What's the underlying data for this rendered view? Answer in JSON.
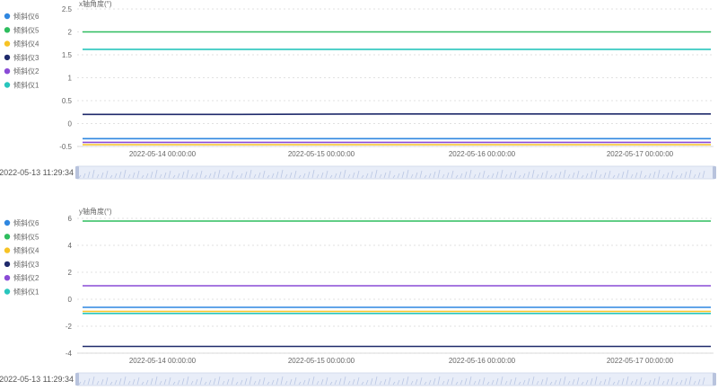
{
  "chart_data": [
    {
      "type": "line",
      "ylabel": "x轴角度(°)",
      "ylim": [
        -0.5,
        2.5
      ],
      "yticks": [
        "2.5",
        "2",
        "1.5",
        "1",
        "0.5",
        "0",
        "-0.5"
      ],
      "x_ticks": [
        "2022-05-14 00:00:00",
        "2022-05-15 00:00:00",
        "2022-05-16 00:00:00",
        "2022-05-17 00:00:00"
      ],
      "x_range": [
        "2022-05-13 11:29:34",
        "2022-05-17 20:00:00"
      ],
      "legend": [
        "倾斜仪6",
        "倾斜仪5",
        "倾斜仪4",
        "倾斜仪3",
        "倾斜仪2",
        "倾斜仪1"
      ],
      "grid": true,
      "series": [
        {
          "name": "倾斜仪6",
          "color": "#2f87e0",
          "values": [
            -0.33,
            -0.33,
            -0.33,
            -0.33,
            -0.33
          ]
        },
        {
          "name": "倾斜仪5",
          "color": "#2ebd5e",
          "values": [
            2.0,
            2.0,
            2.0,
            2.0,
            2.0
          ]
        },
        {
          "name": "倾斜仪4",
          "color": "#f7c325",
          "values": [
            -0.46,
            -0.46,
            -0.46,
            -0.46,
            -0.46
          ]
        },
        {
          "name": "倾斜仪3",
          "color": "#1f2a6b",
          "values": [
            0.2,
            0.2,
            0.21,
            0.21,
            0.21
          ]
        },
        {
          "name": "倾斜仪2",
          "color": "#8a4bd6",
          "values": [
            -0.41,
            -0.41,
            -0.41,
            -0.41,
            -0.41
          ]
        },
        {
          "name": "倾斜仪1",
          "color": "#28c6bd",
          "values": [
            1.62,
            1.62,
            1.62,
            1.62,
            1.62
          ]
        }
      ],
      "slider_label": "2022-05-13 11:29:34"
    },
    {
      "type": "line",
      "ylabel": "y轴角度(°)",
      "ylim": [
        -4,
        6
      ],
      "yticks": [
        "6",
        "4",
        "2",
        "0",
        "-2",
        "-4"
      ],
      "x_ticks": [
        "2022-05-14 00:00:00",
        "2022-05-15 00:00:00",
        "2022-05-16 00:00:00",
        "2022-05-17 00:00:00"
      ],
      "x_range": [
        "2022-05-13 11:29:34",
        "2022-05-17 20:00:00"
      ],
      "legend": [
        "倾斜仪6",
        "倾斜仪5",
        "倾斜仪4",
        "倾斜仪3",
        "倾斜仪2",
        "倾斜仪1"
      ],
      "grid": true,
      "series": [
        {
          "name": "倾斜仪6",
          "color": "#2f87e0",
          "values": [
            -0.6,
            -0.6,
            -0.6,
            -0.6,
            -0.6
          ]
        },
        {
          "name": "倾斜仪5",
          "color": "#2ebd5e",
          "values": [
            5.8,
            5.8,
            5.8,
            5.8,
            5.8
          ]
        },
        {
          "name": "倾斜仪4",
          "color": "#f7c325",
          "values": [
            -0.9,
            -0.9,
            -0.9,
            -0.9,
            -0.9
          ]
        },
        {
          "name": "倾斜仪3",
          "color": "#1f2a6b",
          "values": [
            -3.5,
            -3.5,
            -3.5,
            -3.5,
            -3.5
          ]
        },
        {
          "name": "倾斜仪2",
          "color": "#8a4bd6",
          "values": [
            1.0,
            1.0,
            1.0,
            1.0,
            1.0
          ]
        },
        {
          "name": "倾斜仪1",
          "color": "#28c6bd",
          "values": [
            -1.05,
            -1.05,
            -1.05,
            -1.05,
            -1.05
          ]
        }
      ],
      "slider_label": "2022-05-13 11:29:34"
    }
  ]
}
